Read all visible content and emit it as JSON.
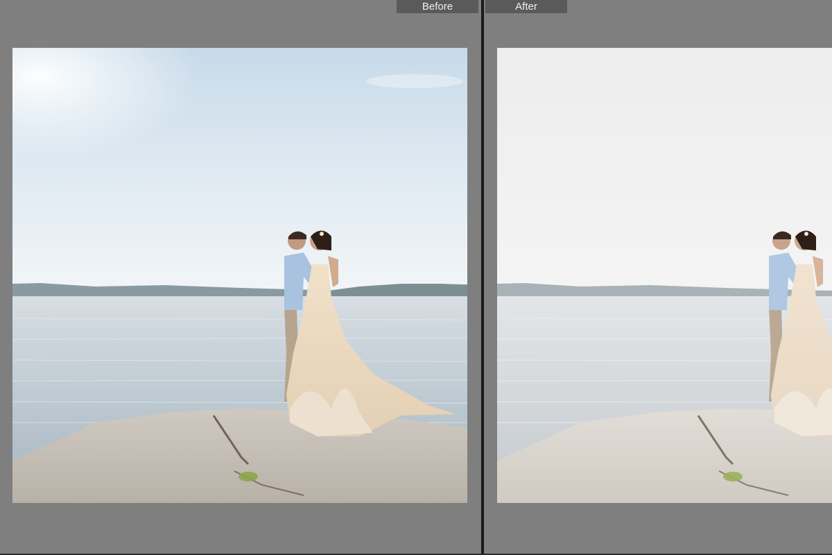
{
  "compare_view": {
    "before_label": "Before",
    "after_label": "After"
  },
  "photo": {
    "subject": "couple-kissing-on-rock-by-lake",
    "colors": {
      "before_sky_top": "#c9dcea",
      "before_sky_bottom": "#f2f6f9",
      "before_water": "#bcc8d0",
      "before_rock": "#c8c1b8",
      "after_sky_top": "#eeeeef",
      "after_sky_bottom": "#f5f5f5",
      "after_water": "#d2d6d9",
      "after_rock": "#dcd6d0",
      "dress": "#ead7bd",
      "shirt": "#a8c2df",
      "trousers": "#b6a48e"
    }
  }
}
